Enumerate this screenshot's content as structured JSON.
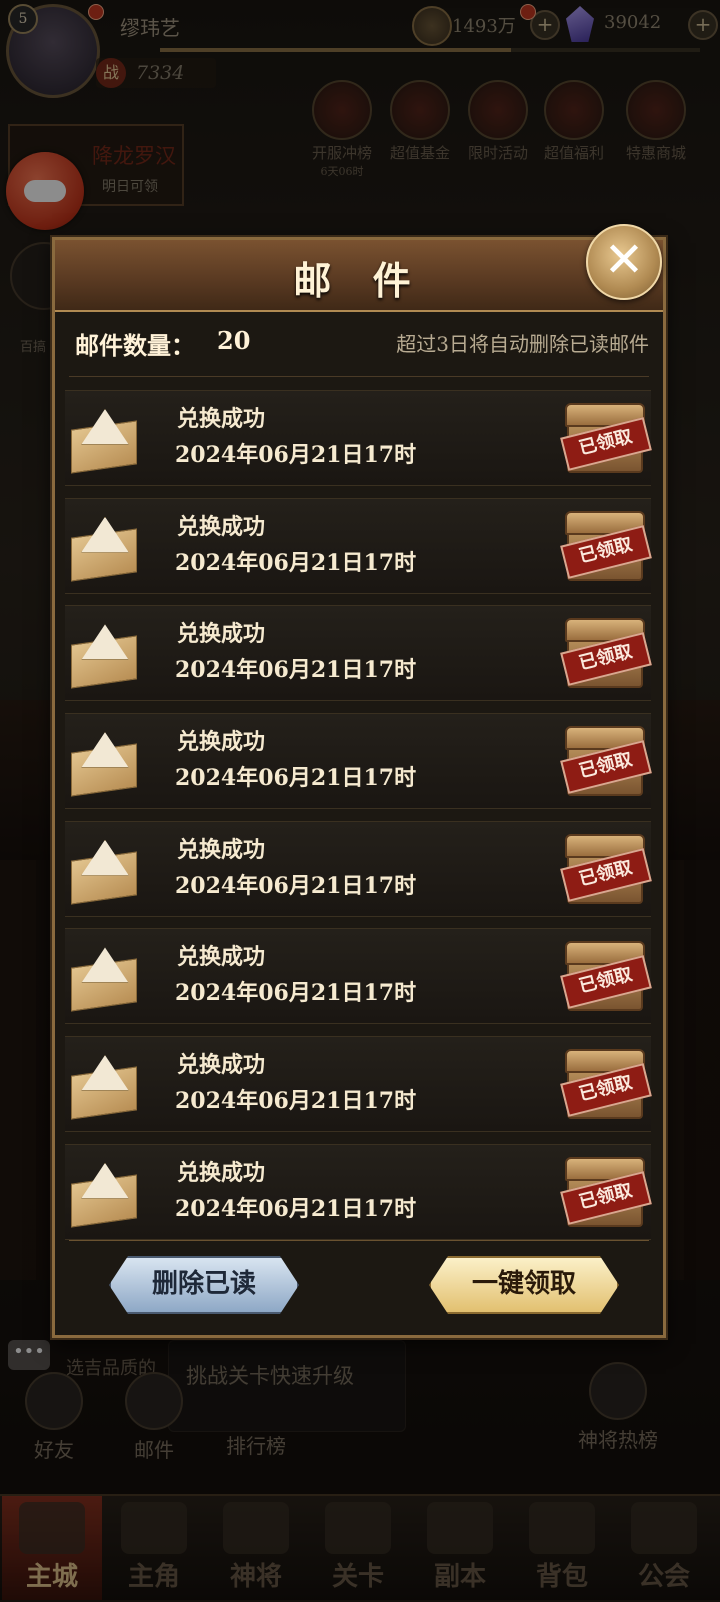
{
  "top": {
    "level": "5",
    "player_name": "缪玮艺",
    "power_icon": "战",
    "power": "7334",
    "coins": "1493万",
    "gems": "39042"
  },
  "activities": [
    {
      "label": "开服冲榜",
      "sub": "6天06时"
    },
    {
      "label": "超值基金",
      "sub": ""
    },
    {
      "label": "限时活动",
      "sub": ""
    },
    {
      "label": "超值福利",
      "sub": ""
    },
    {
      "label": "特惠商城",
      "sub": ""
    }
  ],
  "left": {
    "card_title": "降龙罗汉",
    "card_sub": "明日可领",
    "side_label": "百搞"
  },
  "modal": {
    "title": "邮 件",
    "close_icon": "close-x-icon",
    "count_label": "邮件数量：",
    "count_value": "20",
    "hint": "超过3日将自动删除已读邮件",
    "items": [
      {
        "title": "兑换成功",
        "date": "2024年06月21日17时",
        "status": "已领取"
      },
      {
        "title": "兑换成功",
        "date": "2024年06月21日17时",
        "status": "已领取"
      },
      {
        "title": "兑换成功",
        "date": "2024年06月21日17时",
        "status": "已领取"
      },
      {
        "title": "兑换成功",
        "date": "2024年06月21日17时",
        "status": "已领取"
      },
      {
        "title": "兑换成功",
        "date": "2024年06月21日17时",
        "status": "已领取"
      },
      {
        "title": "兑换成功",
        "date": "2024年06月21日17时",
        "status": "已领取"
      },
      {
        "title": "兑换成功",
        "date": "2024年06月21日17时",
        "status": "已领取"
      },
      {
        "title": "兑换成功",
        "date": "2024年06月21日17时",
        "status": "已领取"
      }
    ],
    "delete_read_label": "删除已读",
    "claim_all_label": "一键领取"
  },
  "behind": {
    "chat_text": "选吉品质的",
    "tip_text": "挑战关卡快速升级",
    "friends": "好友",
    "mail": "邮件",
    "ranking": "排行榜",
    "hot_list": "神将热榜"
  },
  "nav": [
    "主城",
    "主角",
    "神将",
    "关卡",
    "副本",
    "背包",
    "公会"
  ],
  "colors": {
    "accent_gold": "#b08a52",
    "stamp_red": "#8e1c14",
    "text_light": "#f6ead0"
  }
}
